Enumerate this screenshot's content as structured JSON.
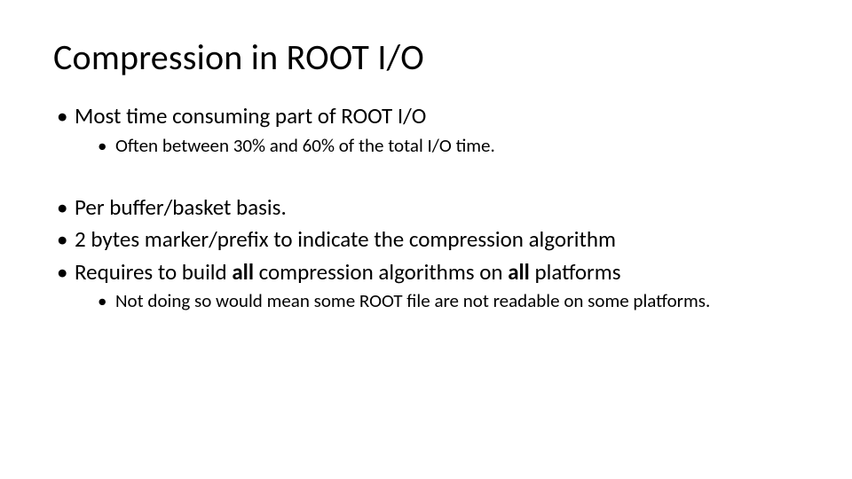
{
  "title": "Compression in ROOT I/O",
  "bullets": {
    "b1": "Most time consuming part of ROOT I/O",
    "b1_1": "Often between 30% and 60% of the total I/O time.",
    "b2": "Per buffer/basket basis.",
    "b3": "2 bytes marker/prefix to indicate the compression algorithm",
    "b4_pre": "Requires to build ",
    "b4_bold1": "all",
    "b4_mid": " compression algorithms on ",
    "b4_bold2": "all",
    "b4_post": " platforms",
    "b4_1": "Not doing so would mean some ROOT file are not readable on some platforms."
  }
}
